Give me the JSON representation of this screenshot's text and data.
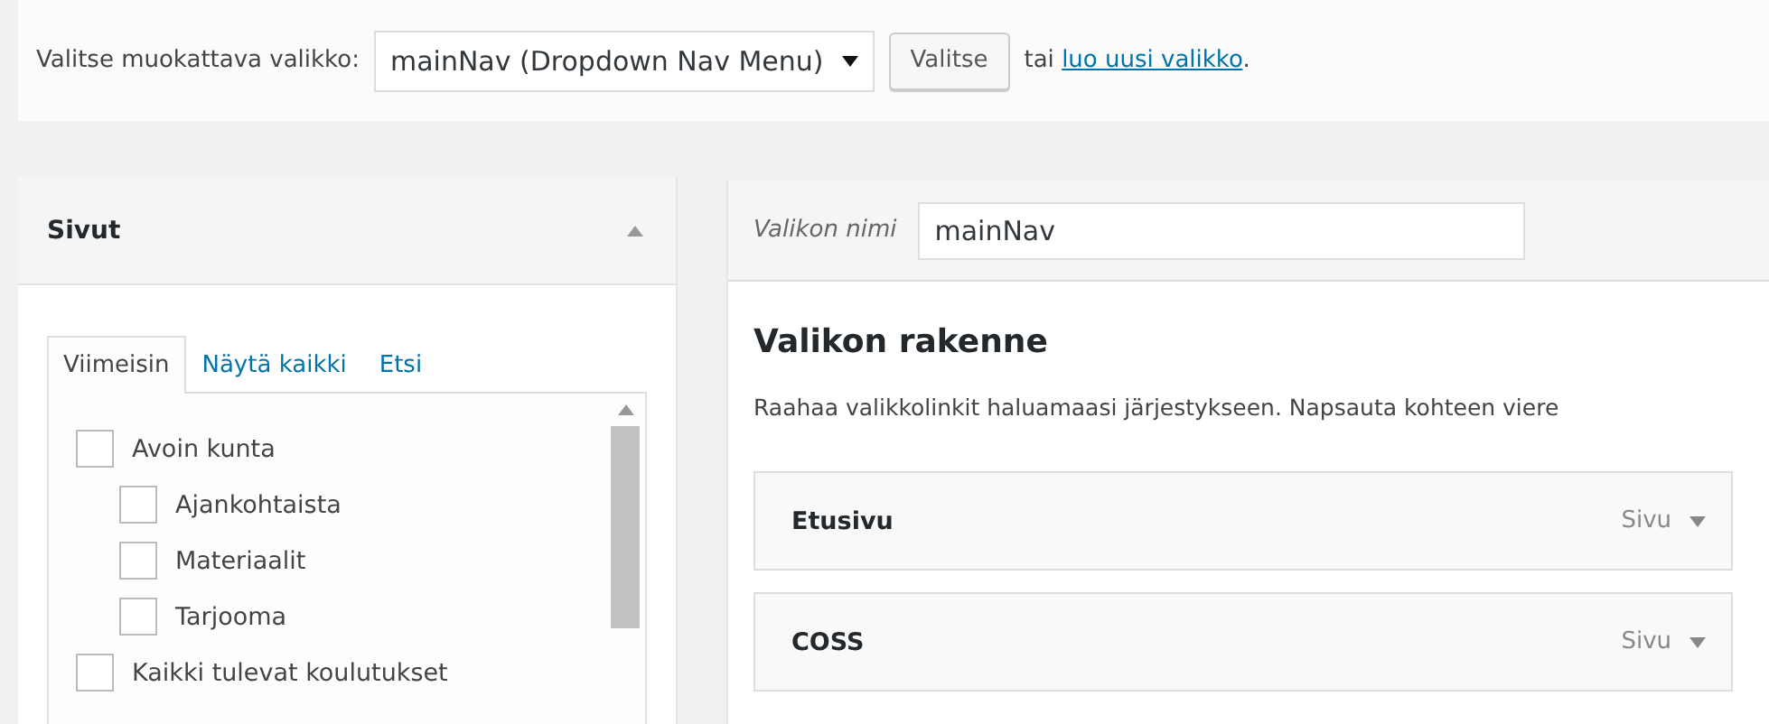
{
  "menu_select": {
    "label": "Valitse muokattava valikko:",
    "value": "mainNav (Dropdown Nav Menu)",
    "button": "Valitse",
    "or_text": "tai",
    "create_link": "luo uusi valikko",
    "after_link": "."
  },
  "pages_panel": {
    "title": "Sivut",
    "expanded": true,
    "tabs": [
      {
        "label": "Viimeisin",
        "selected": true
      },
      {
        "label": "Näytä kaikki",
        "selected": false
      },
      {
        "label": "Etsi",
        "selected": false
      }
    ],
    "items": [
      {
        "label": "Avoin kunta",
        "checked": false,
        "children": [
          {
            "label": "Ajankohtaista",
            "checked": false
          },
          {
            "label": "Materiaalit",
            "checked": false
          },
          {
            "label": "Tarjooma",
            "checked": false
          }
        ]
      },
      {
        "label": "Kaikki tulevat koulutukset",
        "checked": false
      }
    ]
  },
  "menu_editor": {
    "name_label": "Valikon nimi",
    "name_value": "mainNav",
    "heading": "Valikon rakenne",
    "instructions": "Raahaa valikkolinkit haluamaasi järjestykseen. Napsauta kohteen viere",
    "items": [
      {
        "title": "Etusivu",
        "type": "Sivu"
      },
      {
        "title": "COSS",
        "type": "Sivu"
      }
    ]
  }
}
